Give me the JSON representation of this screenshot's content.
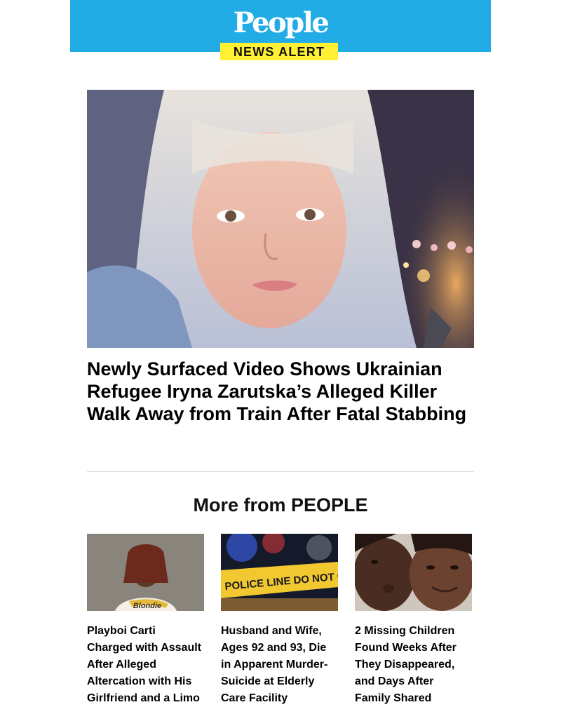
{
  "brand": {
    "logo_text": "People",
    "tagline": "NEWS ALERT",
    "header_color": "#21ace6",
    "tag_color": "#fff034"
  },
  "main_story": {
    "headline": "Newly Surfaced Video Shows Ukrainian Refugee Iryna Zarutska’s Alleged Killer Walk Away from Train After Fatal Stabbing"
  },
  "more_section": {
    "title": "More from PEOPLE",
    "cards": [
      {
        "title": "Playboi Carti Charged with Assault After Alleged Altercation with His Girlfriend and a Limo",
        "shirt_text": "Blondie"
      },
      {
        "title": "Husband and Wife, Ages 92 and 93, Die in Apparent Murder-Suicide at Elderly Care Facility",
        "tape_text": "POLICE LINE DO NOT CROSS"
      },
      {
        "title": "2 Missing Children Found Weeks After They Disappeared, and Days After Family Shared"
      }
    ]
  }
}
